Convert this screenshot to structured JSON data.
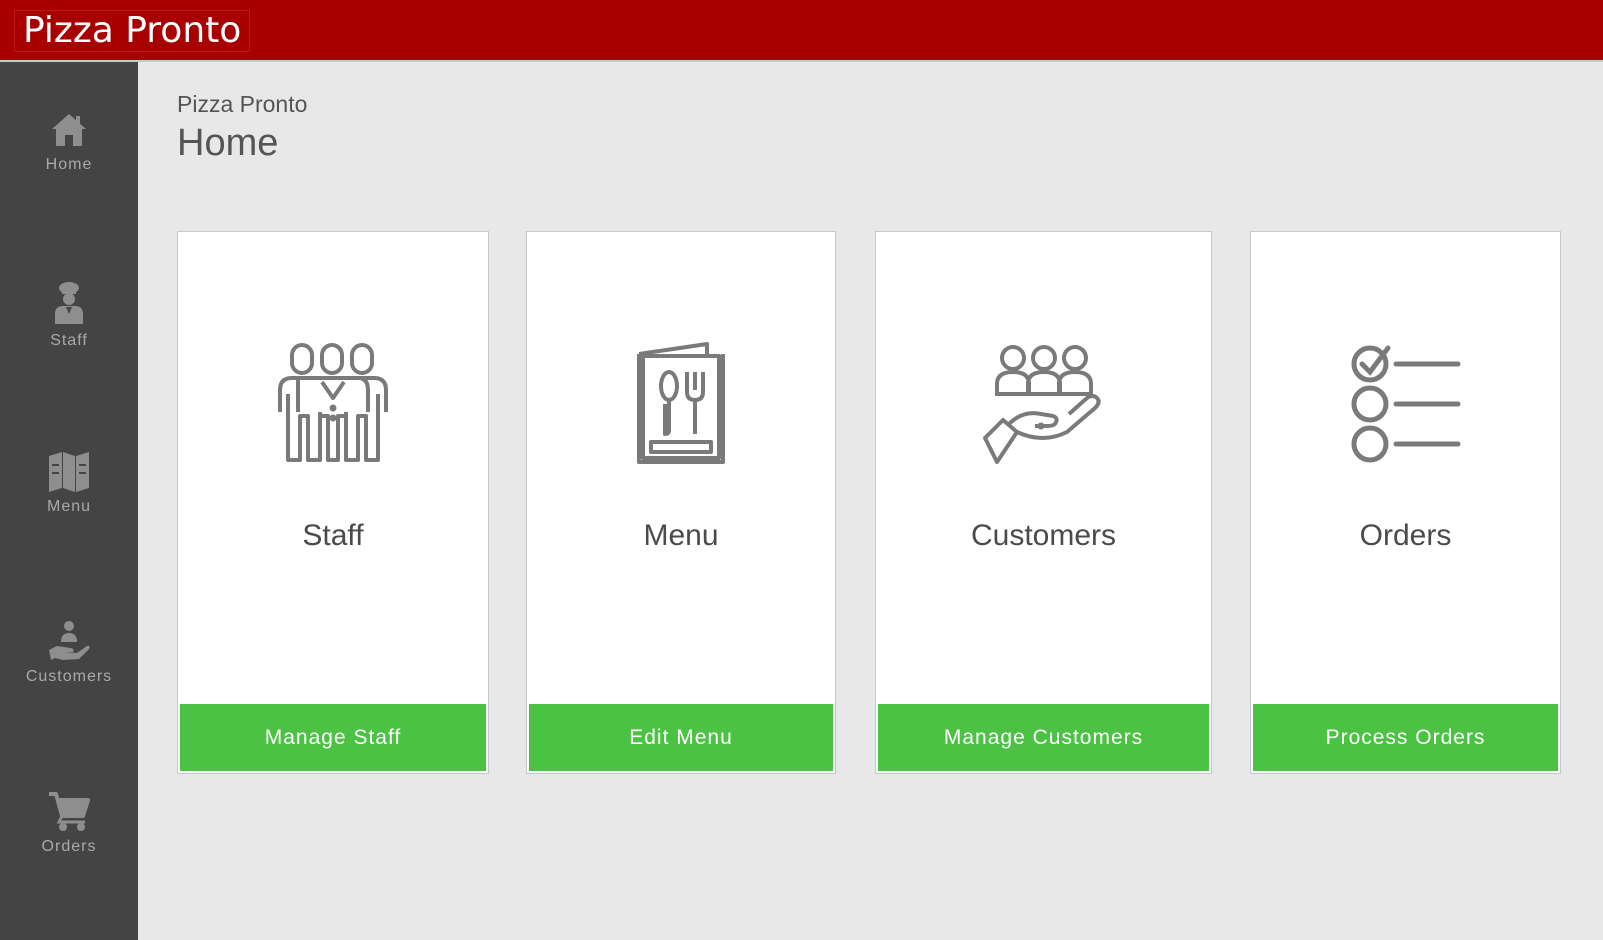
{
  "app": {
    "brand": "Pizza Pronto"
  },
  "header": {
    "subtitle": "Pizza Pronto",
    "title": "Home"
  },
  "sidebar": {
    "items": [
      {
        "label": "Home",
        "icon": "home-icon"
      },
      {
        "label": "Staff",
        "icon": "chef-icon"
      },
      {
        "label": "Menu",
        "icon": "map-icon"
      },
      {
        "label": "Customers",
        "icon": "serving-hand-icon"
      },
      {
        "label": "Orders",
        "icon": "cart-icon"
      }
    ]
  },
  "cards": [
    {
      "title": "Staff",
      "button": "Manage Staff",
      "icon": "staff-group-icon"
    },
    {
      "title": "Menu",
      "button": "Edit Menu",
      "icon": "menu-book-icon"
    },
    {
      "title": "Customers",
      "button": "Manage Customers",
      "icon": "customers-hand-icon"
    },
    {
      "title": "Orders",
      "button": "Process Orders",
      "icon": "checklist-icon"
    }
  ],
  "colors": {
    "topbar": "#a80000",
    "sidebar": "#444444",
    "sidebar_icon": "#8e8e8e",
    "content_bg": "#e8e8e8",
    "button": "#4cc244",
    "card_icon": "#7a7a7a"
  }
}
